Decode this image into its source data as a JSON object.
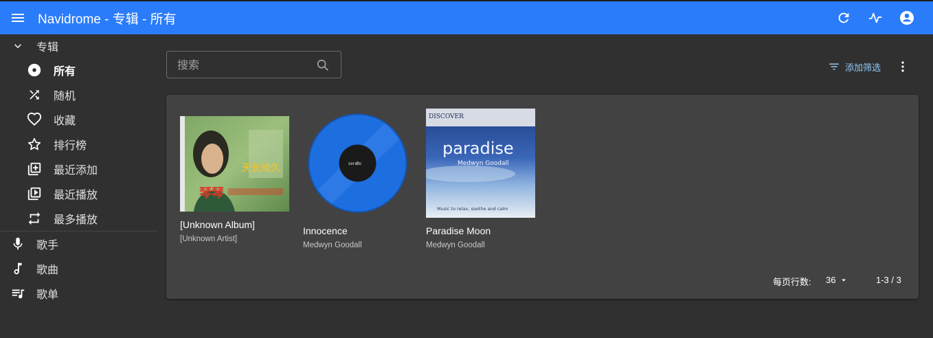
{
  "appbar": {
    "title": "Navidrome - 专辑 - 所有",
    "menu_icon": "menu-icon",
    "actions": [
      "refresh-icon",
      "activity-icon",
      "account-icon"
    ],
    "color": "#2a7cfb"
  },
  "sidebar": {
    "albums_label": "专辑",
    "items": [
      {
        "label": "所有",
        "icon": "album-disc-icon",
        "active": true
      },
      {
        "label": "随机",
        "icon": "shuffle-icon"
      },
      {
        "label": "收藏",
        "icon": "heart-icon"
      },
      {
        "label": "排行榜",
        "icon": "star-icon"
      },
      {
        "label": "最近添加",
        "icon": "library-add-icon"
      },
      {
        "label": "最近播放",
        "icon": "video-library-icon"
      },
      {
        "label": "最多播放",
        "icon": "repeat-icon"
      }
    ],
    "artists_label": "歌手",
    "songs_label": "歌曲",
    "playlists_label": "歌单"
  },
  "search": {
    "placeholder": "搜索"
  },
  "toolbar": {
    "add_filter": "添加筛选"
  },
  "albums": [
    {
      "name": "[Unknown Album]",
      "artist": "[Unknown Artist]"
    },
    {
      "name": "Innocence",
      "artist": "Medwyn Goodall"
    },
    {
      "name": "Paradise Moon",
      "artist": "Medwyn Goodall"
    }
  ],
  "covers": {
    "paradise_top": "DISCOVER",
    "paradise_title": "paradise",
    "paradise_artist": "Medwyn Goodall",
    "paradise_tagline": "Music to relax, soothe and calm",
    "serato": "serato"
  },
  "pagination": {
    "rows_label": "每页行数:",
    "rows_value": "36",
    "range": "1-3 / 3"
  }
}
